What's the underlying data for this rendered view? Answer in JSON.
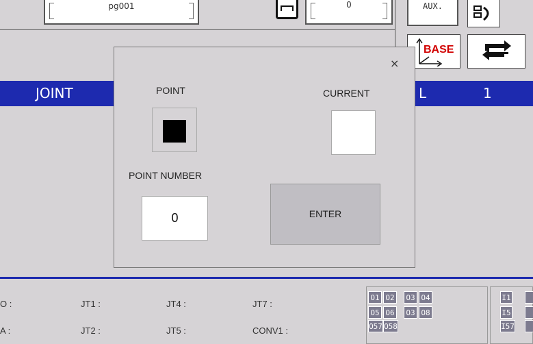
{
  "top": {
    "program_field": "pg001",
    "step_field": "0",
    "aux_label": "AUX."
  },
  "toolbar": {
    "base_label": "BASE"
  },
  "header": {
    "mode": "JOINT",
    "tool_label_partial": "L",
    "tool_number": "1"
  },
  "dialog": {
    "point_label": "POINT",
    "current_label": "CURRENT",
    "point_number_label": "POINT NUMBER",
    "point_number_value": "0",
    "enter_label": "ENTER",
    "close_label": "×"
  },
  "joints": {
    "row1": [
      "O :",
      "JT1 :",
      "JT4 :",
      "JT7 :"
    ],
    "row2": [
      "A :",
      "JT2 :",
      "JT5 :",
      "CONV1 :"
    ]
  },
  "outputs": {
    "row1": [
      "O1",
      "O2",
      "O3",
      "O4"
    ],
    "row2": [
      "O5",
      "O6",
      "O3",
      "O8"
    ],
    "row3": [
      "O57",
      "O58"
    ]
  },
  "inputs": {
    "row1": [
      "I1"
    ],
    "row2": [
      "I5"
    ],
    "row3": [
      "I57"
    ]
  },
  "colors": {
    "header_blue": "#1d2aaf",
    "io_cell": "#7d7b8f",
    "background": "#d6d3d6"
  }
}
